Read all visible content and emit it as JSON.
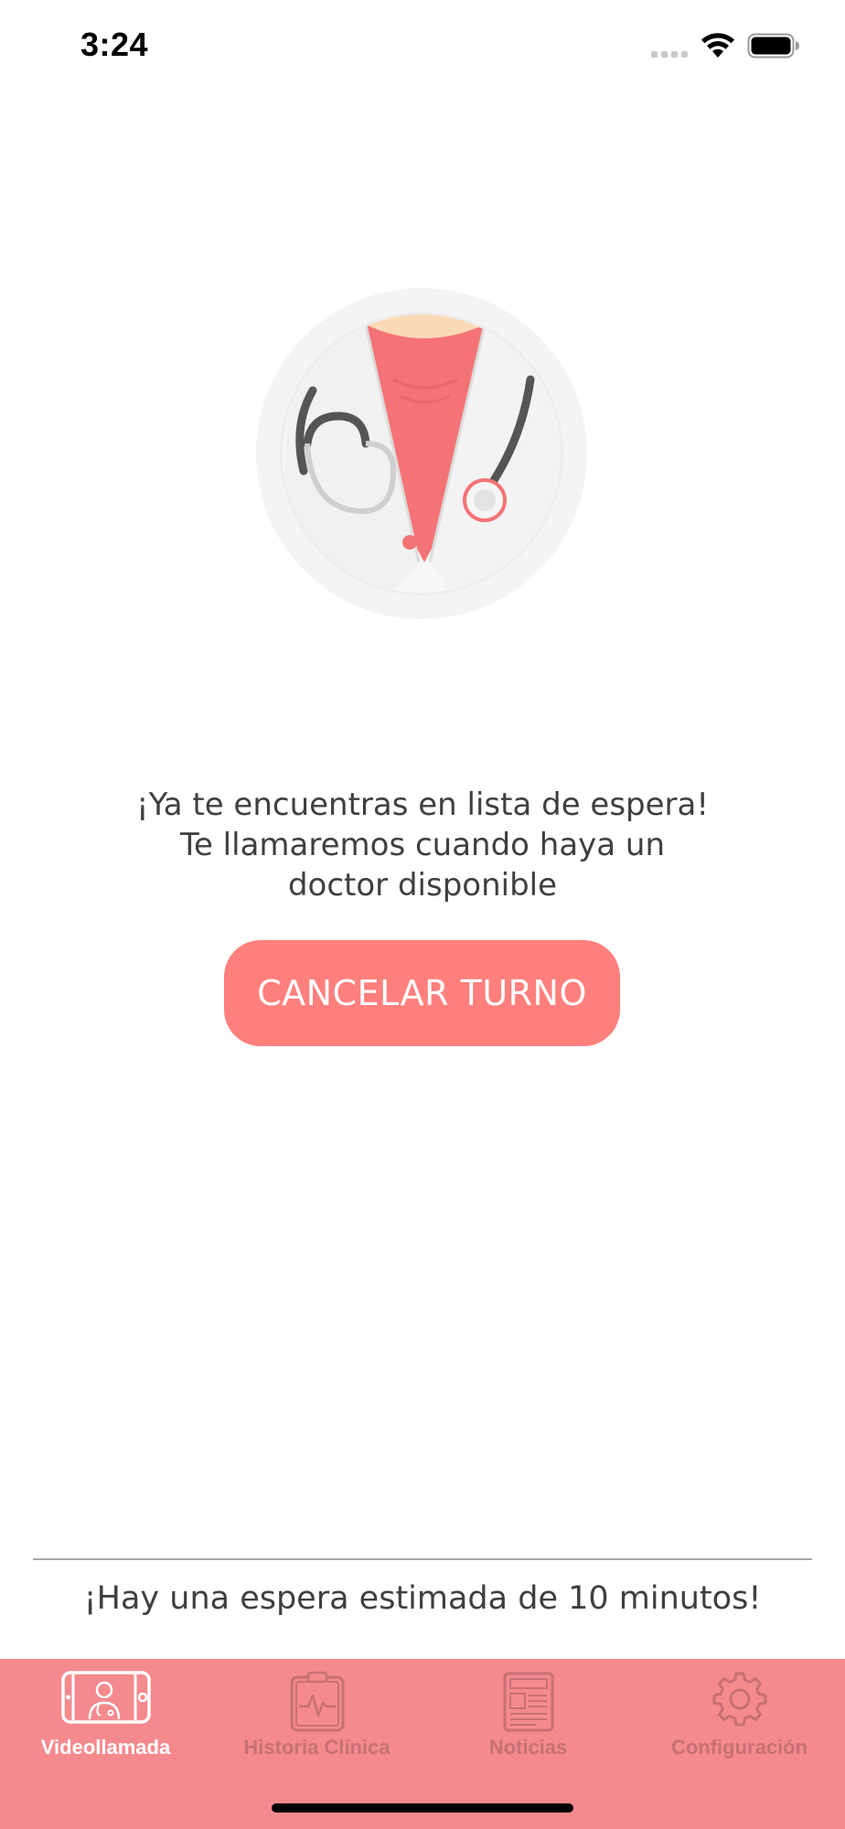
{
  "status_bar": {
    "time": "3:24"
  },
  "illustration": {
    "icon": "doctor-illustration",
    "colors": {
      "accent": "#f47376",
      "coat": "#f3f3f3",
      "skin": "#fcd9b6",
      "stethoscope": "#555555"
    }
  },
  "message": {
    "line1": "¡Ya te encuentras en lista de espera!",
    "line2": "Te llamaremos cuando haya un",
    "line3": "doctor disponible"
  },
  "cancel_button": {
    "label": "CANCELAR TURNO",
    "color": "#ff7f7c"
  },
  "footer": {
    "estimated_wait": "¡Hay una espera estimada de 10 minutos!"
  },
  "tab_bar": {
    "background": "#f48a8e",
    "tabs": [
      {
        "label": "Videollamada",
        "icon": "videocall-icon",
        "active": true
      },
      {
        "label": "Historia Clínica",
        "icon": "clipboard-health-icon",
        "active": false
      },
      {
        "label": "Noticias",
        "icon": "newspaper-icon",
        "active": false
      },
      {
        "label": "Configuración",
        "icon": "gear-icon",
        "active": false
      }
    ]
  }
}
